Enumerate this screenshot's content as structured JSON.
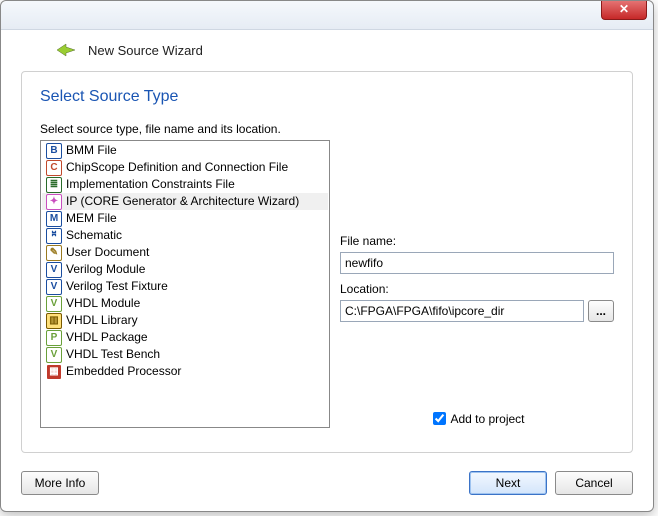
{
  "window": {
    "close_glyph": "✕"
  },
  "header": {
    "wizard_title": "New Source Wizard"
  },
  "page": {
    "title": "Select Source Type",
    "subtitle": "Select source type, file name and its location."
  },
  "source_types": [
    {
      "label": "BMM File",
      "icon_text": "B",
      "icon_bg": "#ffffff",
      "icon_fg": "#1b4ea0",
      "selected": false
    },
    {
      "label": "ChipScope Definition and Connection File",
      "icon_text": "C",
      "icon_bg": "#ffffff",
      "icon_fg": "#c1492c",
      "selected": false
    },
    {
      "label": "Implementation Constraints File",
      "icon_text": "≣",
      "icon_bg": "#ffffff",
      "icon_fg": "#2a6b2a",
      "selected": false
    },
    {
      "label": "IP (CORE Generator & Architecture Wizard)",
      "icon_text": "✦",
      "icon_bg": "#ffffff",
      "icon_fg": "#c94fbf",
      "selected": true
    },
    {
      "label": "MEM File",
      "icon_text": "M",
      "icon_bg": "#ffffff",
      "icon_fg": "#1b4ea0",
      "selected": false
    },
    {
      "label": "Schematic",
      "icon_text": "⎶",
      "icon_bg": "#ffffff",
      "icon_fg": "#1b4ea0",
      "selected": false
    },
    {
      "label": "User Document",
      "icon_text": "✎",
      "icon_bg": "#ffffff",
      "icon_fg": "#9a7a20",
      "selected": false
    },
    {
      "label": "Verilog Module",
      "icon_text": "V",
      "icon_bg": "#ffffff",
      "icon_fg": "#1b4ea0",
      "selected": false
    },
    {
      "label": "Verilog Test Fixture",
      "icon_text": "V",
      "icon_bg": "#ffffff",
      "icon_fg": "#1b4ea0",
      "selected": false
    },
    {
      "label": "VHDL Module",
      "icon_text": "V",
      "icon_bg": "#ffffff",
      "icon_fg": "#6aa03a",
      "selected": false
    },
    {
      "label": "VHDL Library",
      "icon_text": "▥",
      "icon_bg": "#ffe07a",
      "icon_fg": "#7a5a00",
      "selected": false
    },
    {
      "label": "VHDL Package",
      "icon_text": "P",
      "icon_bg": "#ffffff",
      "icon_fg": "#6aa03a",
      "selected": false
    },
    {
      "label": "VHDL Test Bench",
      "icon_text": "V",
      "icon_bg": "#ffffff",
      "icon_fg": "#6aa03a",
      "selected": false
    },
    {
      "label": "Embedded Processor",
      "icon_text": "▦",
      "icon_bg": "#c0392b",
      "icon_fg": "#ffffff",
      "selected": false
    }
  ],
  "fields": {
    "file_name_label": "File name:",
    "file_name_value": "newfifo",
    "location_label": "Location:",
    "location_value": "C:\\FPGA\\FPGA\\fifo\\ipcore_dir",
    "browse_glyph": "...",
    "add_to_project_label": "Add to project",
    "add_to_project_checked": true
  },
  "footer": {
    "more_info": "More Info",
    "next": "Next",
    "cancel": "Cancel"
  }
}
